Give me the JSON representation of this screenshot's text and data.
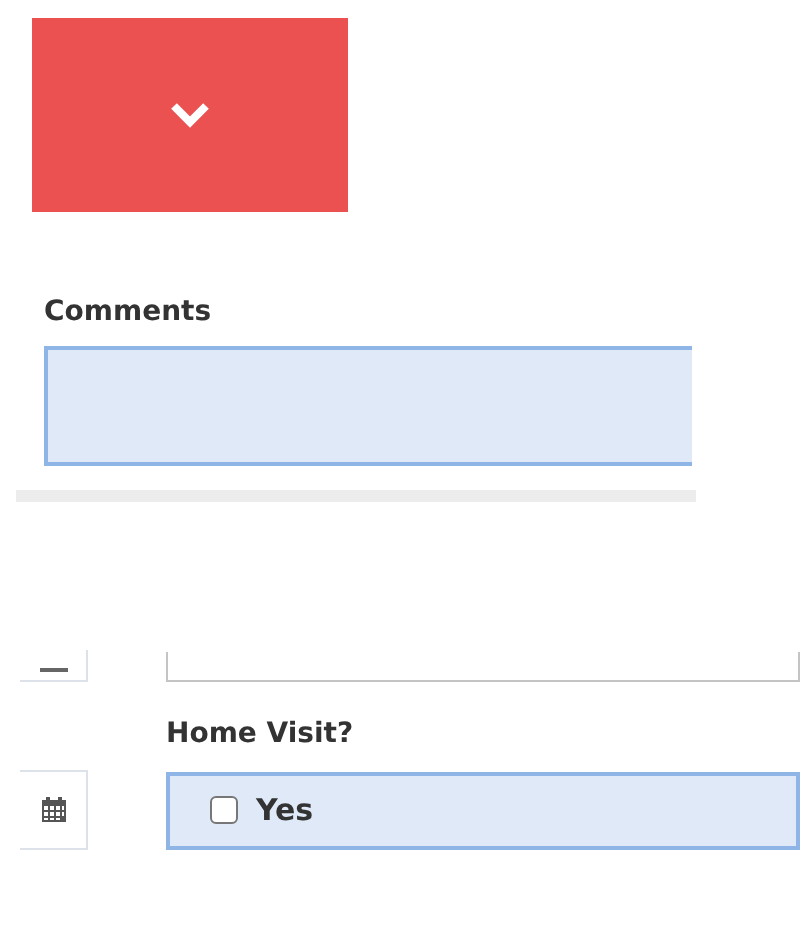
{
  "comments": {
    "label": "Comments"
  },
  "home_visit": {
    "label": "Home Visit?",
    "option": "Yes",
    "checked": false
  }
}
